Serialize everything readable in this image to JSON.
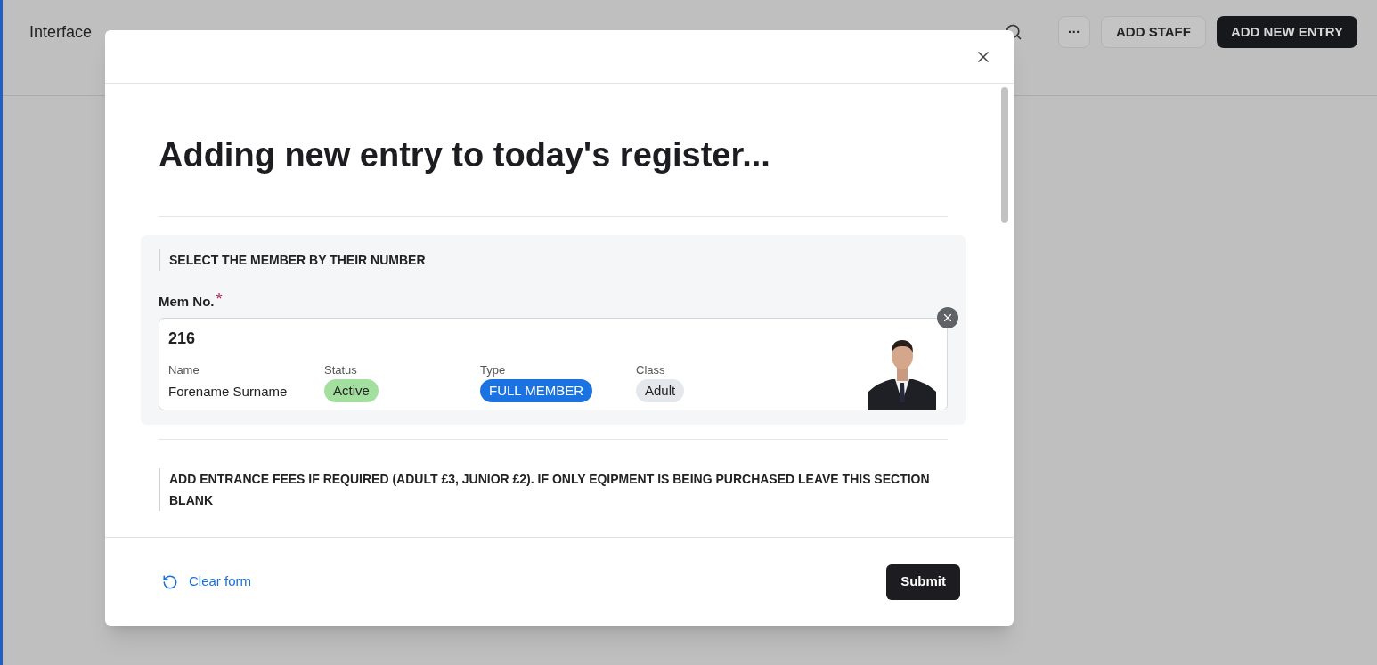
{
  "breadcrumb": {
    "items": [
      "Interface"
    ]
  },
  "toolbar": {
    "buttons": [
      {
        "label": "···",
        "kind": "more"
      },
      {
        "label": "ADD STAFF",
        "kind": "secondary"
      },
      {
        "label": "ADD NEW ENTRY",
        "kind": "primary"
      }
    ]
  },
  "dialog": {
    "title": "Adding new entry to today's register...",
    "sections": [
      {
        "heading": "SELECT THE MEMBER BY THEIR NUMBER",
        "field": {
          "label": "Mem No.",
          "required_mark": "*",
          "value": "216",
          "details": [
            {
              "label": "Name",
              "value": "Forename Surname",
              "kind": "text"
            },
            {
              "label": "Status",
              "value": "Active",
              "kind": "pill",
              "color": "#a3e0a0"
            },
            {
              "label": "Type",
              "value": "FULL MEMBER",
              "kind": "pill",
              "color": "#1a73e0"
            },
            {
              "label": "Class",
              "value": "Adult",
              "kind": "pill",
              "color": "#e4e7ec"
            }
          ]
        }
      },
      {
        "heading": "ADD ENTRANCE FEES IF REQUIRED (ADULT £3, JUNIOR £2).  IF ONLY EQIPMENT IS BEING PURCHASED LEAVE THIS SECTION BLANK"
      }
    ],
    "clear_label": "Clear form",
    "submit_label": "Submit"
  }
}
